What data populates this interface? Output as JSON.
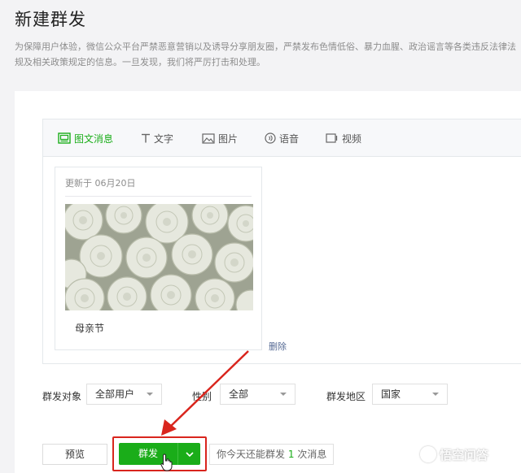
{
  "page": {
    "title": "新建群发",
    "notice": "为保障用户体验，微信公众平台严禁恶意营销以及诱导分享朋友圈，严禁发布色情低俗、暴力血腥、政治谣言等各类违反法律法规及相关政策规定的信息。一旦发现，我们将严厉打击和处理。"
  },
  "tabs": [
    {
      "label": "图文消息",
      "icon": "article-icon",
      "active": true
    },
    {
      "label": "文字",
      "icon": "text-icon"
    },
    {
      "label": "图片",
      "icon": "image-icon"
    },
    {
      "label": "语音",
      "icon": "voice-icon"
    },
    {
      "label": "视频",
      "icon": "video-icon"
    }
  ],
  "article": {
    "updated": "更新于 06月20日",
    "title": "母亲节",
    "cover": "white-roses-photo"
  },
  "delete_label": "删除",
  "filters": {
    "target_label": "群发对象",
    "target_value": "全部用户",
    "gender_label": "性别",
    "gender_value": "全部",
    "region_label": "群发地区",
    "region_value": "国家"
  },
  "actions": {
    "preview": "预览",
    "send": "群发",
    "quota_prefix": "你今天还能群发",
    "quota_count": "1",
    "quota_suffix": "次消息"
  },
  "watermark": "悟空问答",
  "colors": {
    "accent": "#1aad19",
    "annotation": "#d9251d",
    "link": "#576b95"
  }
}
